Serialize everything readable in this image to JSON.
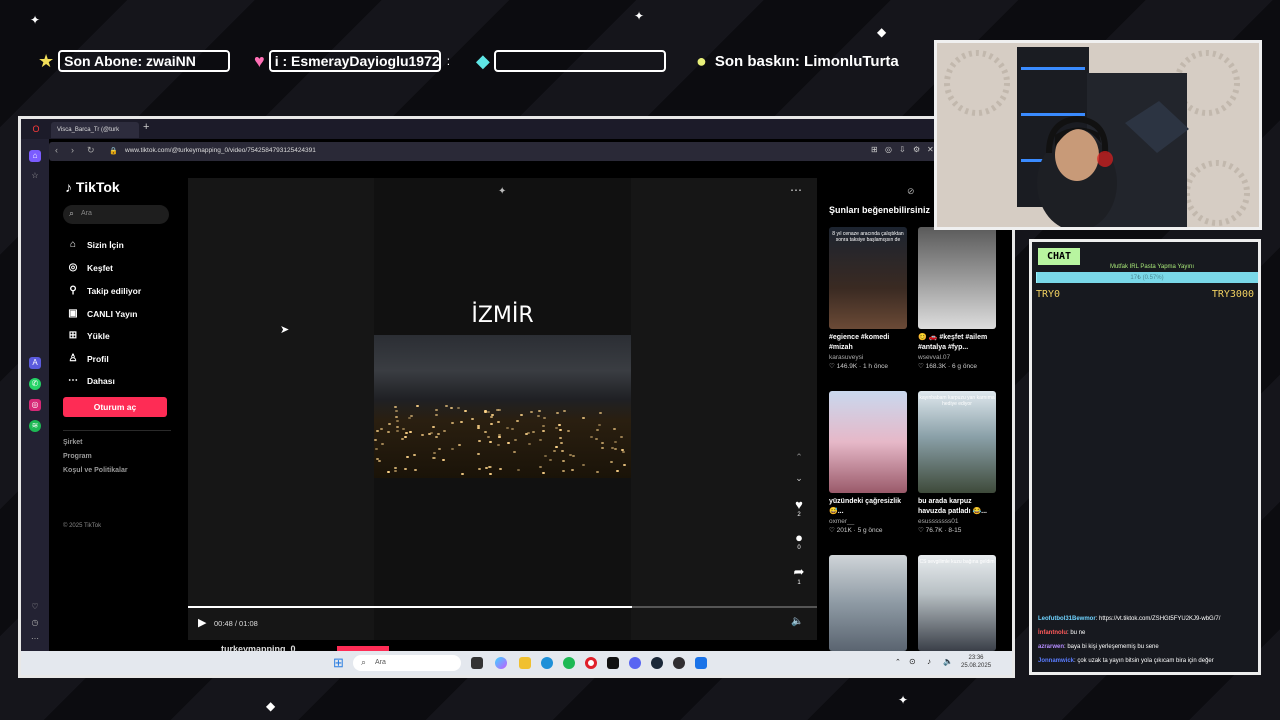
{
  "overlay": {
    "last_sub": "Son Abone: zwaiNN",
    "donor": "i : EsmerayDayioglu1972",
    "donor_extra": ":",
    "last_raid": "Son baskın: LimonluTurta"
  },
  "browser": {
    "tab_title": "Visca_Barca_Tr (@turk",
    "url": "www.tiktok.com/@turkeymapping_0/video/7542584793125424391"
  },
  "tiktok": {
    "logo": "TikTok",
    "search_placeholder": "Ara",
    "nav": [
      {
        "label": "Sizin İçin",
        "icon": "home-icon"
      },
      {
        "label": "Keşfet",
        "icon": "compass-icon"
      },
      {
        "label": "Takip ediliyor",
        "icon": "following-icon"
      },
      {
        "label": "CANLI Yayın",
        "icon": "live-icon"
      },
      {
        "label": "Yükle",
        "icon": "upload-icon"
      },
      {
        "label": "Profil",
        "icon": "profile-icon"
      },
      {
        "label": "Dahası",
        "icon": "more-icon"
      }
    ],
    "login": "Oturum aç",
    "footer": [
      "Şirket",
      "Program",
      "Koşul ve Politikalar"
    ],
    "copyright": "© 2025 TikTok"
  },
  "video": {
    "title": "İZMİR",
    "time": "00:48 / 01:08",
    "progress": 0.706,
    "likes": "2",
    "comments": "0",
    "shares": "1",
    "author": "turkeymapping_0"
  },
  "suggestions": {
    "title": "Şunları beğenebilirsiniz",
    "cards": [
      {
        "thumb_text": "8 yıl cenaze aracında çalıştıktan sonra taksiye başlamışsın de",
        "caption": "#egience #komedi #mizah",
        "user": "karasuveysi",
        "meta": "♡ 146.9K · 1 h önce"
      },
      {
        "thumb_text": "",
        "caption": "😊 🚗 #keşfet #ailem #antalya #fyp...",
        "user": "wsevval.07",
        "meta": "♡ 168.3K · 6 g önce"
      },
      {
        "thumb_text": "",
        "caption": "yüzündeki çağresizlik 😅...",
        "user": "oxmer__",
        "meta": "♡ 201K · 5 g önce"
      },
      {
        "thumb_text": "kayınbabam karpuzu yan karnıma hediye ediyor",
        "caption": "bu arada karpuz havuzda patladı 😂...",
        "user": "esusssssss01",
        "meta": "♡ 76.7K · 8-15"
      },
      {
        "thumb_text": "",
        "caption": "",
        "user": "",
        "meta": ""
      },
      {
        "thumb_text": "CS sevgilimle kuzu bağına geldim",
        "caption": "",
        "user": "",
        "meta": ""
      }
    ]
  },
  "taskbar": {
    "search": "Ara",
    "time": "23:36",
    "date": "25.08.2025"
  },
  "chat": {
    "badge": "CHAT",
    "goal_title": "Mutfak IRL Pasta Yapma Yayını",
    "goal_bar": "17₺ (0.57%)",
    "goal_progress": 0.0057,
    "goal_min": "TRY0",
    "goal_max": "TRY3000",
    "messages": [
      {
        "user": "Leofutbol31Bewmor",
        "text": ": https://vt.tiktok.com/ZSHGt5FYU2KJ9-wbG/7/",
        "color": "#6fd3ff"
      },
      {
        "user": "İnfantnolu",
        "text": ": bu ne",
        "color": "#ff5a5a"
      },
      {
        "user": "azrarwen",
        "text": ": baya bi kişi yerleşememiş bu sene",
        "color": "#b48cff"
      },
      {
        "user": "Jonnamwick",
        "text": ": çok uzak ta yayın bitsin yola çıkıcam bira için değer",
        "color": "#5a7cff"
      }
    ]
  },
  "colors": {
    "accent": "#fe2c55",
    "chat_goal": "#9bf2ff"
  }
}
